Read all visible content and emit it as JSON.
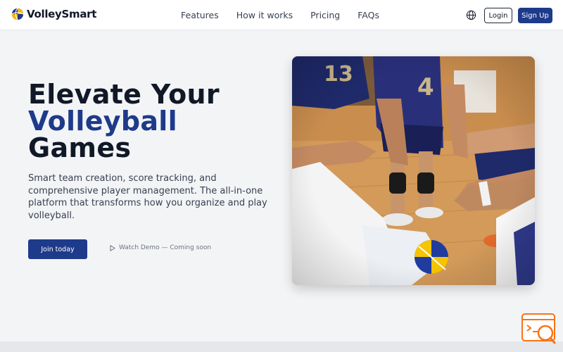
{
  "brand": {
    "name": "VolleySmart"
  },
  "nav": {
    "links": [
      "Features",
      "How it works",
      "Pricing",
      "FAQs"
    ],
    "login_label": "Login",
    "signup_label": "Sign Up"
  },
  "hero": {
    "headline_line1": "Elevate Your",
    "headline_line2": "Volleyball",
    "headline_line3": "Games",
    "subtitle": "Smart team creation, score tracking, and comprehensive player management. The all-in-one platform that transforms how you organize and play volleyball.",
    "join_label": "Join today",
    "watch_demo_label": "Watch Demo — Coming soon"
  },
  "icons": {
    "logo": "volleyball-icon",
    "language": "globe-icon",
    "demo": "play-icon",
    "help": "search-chat-icon"
  },
  "colors": {
    "accent": "#1e3a8a",
    "background": "#f3f4f6",
    "text": "#111827",
    "widget": "#f97316"
  }
}
